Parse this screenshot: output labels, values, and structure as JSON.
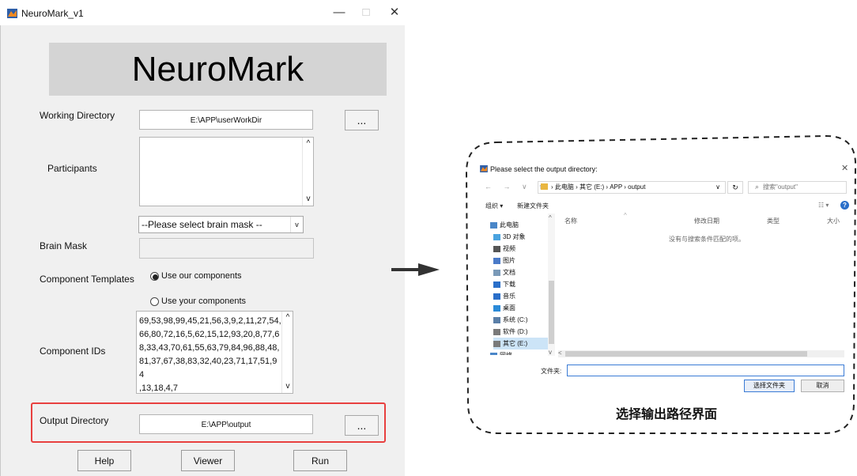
{
  "app": {
    "title": "NeuroMark_v1",
    "window_controls": {
      "minimize": "—",
      "maximize": "□",
      "close": "✕"
    },
    "banner": "NeuroMark",
    "working_directory": {
      "label": "Working Directory",
      "value": "E:\\APP\\userWorkDir",
      "browse": "..."
    },
    "participants": {
      "label": "Participants",
      "value": ""
    },
    "brain_mask": {
      "label": "Brain Mask",
      "dropdown_value": "--Please select brain mask --",
      "value": ""
    },
    "component_templates": {
      "label": "Component Templates",
      "options": [
        {
          "label": "Use our components",
          "selected": true
        },
        {
          "label": "Use your components",
          "selected": false
        }
      ]
    },
    "component_ids": {
      "label": "Component IDs",
      "lines": [
        "69,53,98,99,45,21,56,3,9,2,11,27,54,",
        "66,80,72,16,5,62,15,12,93,20,8,77,6",
        "8,33,43,70,61,55,63,79,84,96,88,48,",
        "81,37,67,38,83,32,40,23,71,17,51,94",
        ",13,18,4,7"
      ]
    },
    "output_directory": {
      "label": "Output Directory",
      "value": "E:\\APP\\output",
      "browse": "..."
    },
    "buttons": {
      "help": "Help",
      "viewer": "Viewer",
      "run": "Run"
    },
    "highlight_color": "#e8403f"
  },
  "dialog": {
    "title": "Please select the output directory:",
    "close": "✕",
    "nav": "← → ∨ ↑",
    "breadcrumb": "› 此电脑 › 其它 (E:) › APP › output",
    "refresh": "↻",
    "search_placeholder": "搜索\"output\"",
    "toolbar": {
      "organize": "组织 ▾",
      "new_folder": "新建文件夹",
      "view": "☷ ▾",
      "help": "?"
    },
    "columns": {
      "name": "名称",
      "modified": "修改日期",
      "type": "类型",
      "size": "大小"
    },
    "empty_message": "没有与搜索条件匹配的项。",
    "tree": [
      {
        "label": "此电脑",
        "icon": "computer-icon",
        "color": "#4a86c8"
      },
      {
        "label": "3D 对象",
        "icon": "cube-icon",
        "color": "#4aa3df"
      },
      {
        "label": "视频",
        "icon": "video-icon",
        "color": "#555555"
      },
      {
        "label": "图片",
        "icon": "image-icon",
        "color": "#4a7ac8"
      },
      {
        "label": "文档",
        "icon": "document-icon",
        "color": "#7a9ab8"
      },
      {
        "label": "下载",
        "icon": "download-icon",
        "color": "#2a6fc9"
      },
      {
        "label": "音乐",
        "icon": "music-icon",
        "color": "#2a6fc9"
      },
      {
        "label": "桌面",
        "icon": "desktop-icon",
        "color": "#2a8ad8"
      },
      {
        "label": "系统 (C:)",
        "icon": "drive-icon",
        "color": "#5a7fa8"
      },
      {
        "label": "软件 (D:)",
        "icon": "drive-icon",
        "color": "#7a7a7a"
      },
      {
        "label": "其它 (E:)",
        "icon": "drive-icon",
        "color": "#7a7a7a",
        "selected": true
      },
      {
        "label": "网络",
        "icon": "network-icon",
        "color": "#4a86c8"
      }
    ],
    "folder_label": "文件夹:",
    "folder_value": "",
    "select_button": "选择文件夹",
    "cancel_button": "取消"
  },
  "caption": "选择输出路径界面"
}
